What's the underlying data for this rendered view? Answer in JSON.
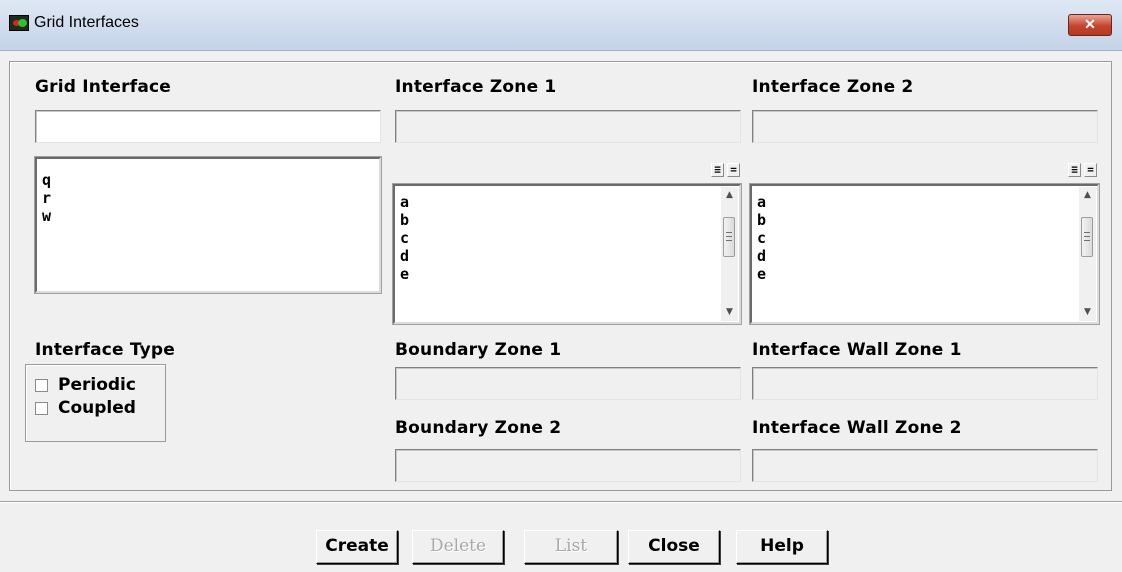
{
  "window": {
    "title": "Grid Interfaces",
    "close_glyph": "✕"
  },
  "grid_interface": {
    "label": "Grid Interface",
    "input_value": "",
    "items": [
      "q",
      "r",
      "w"
    ]
  },
  "zone1": {
    "label": "Interface Zone 1",
    "value": "",
    "items": [
      "a",
      "b",
      "c",
      "d",
      "e"
    ]
  },
  "zone2": {
    "label": "Interface Zone 2",
    "value": "",
    "items": [
      "a",
      "b",
      "c",
      "d",
      "e"
    ]
  },
  "list_select": {
    "all_glyph": "≡",
    "none_glyph": "="
  },
  "scroll": {
    "up_glyph": "▲",
    "down_glyph": "▼"
  },
  "interface_type": {
    "label": "Interface Type",
    "options": [
      {
        "label": "Periodic",
        "checked": false
      },
      {
        "label": "Coupled",
        "checked": false
      }
    ]
  },
  "boundary": {
    "zone1_label": "Boundary Zone 1",
    "zone1_value": "",
    "zone2_label": "Boundary Zone 2",
    "zone2_value": ""
  },
  "wall": {
    "zone1_label": "Interface Wall Zone 1",
    "zone1_value": "",
    "zone2_label": "Interface Wall Zone 2",
    "zone2_value": ""
  },
  "buttons": {
    "create": "Create",
    "delete": "Delete",
    "list": "List",
    "close": "Close",
    "help": "Help"
  }
}
